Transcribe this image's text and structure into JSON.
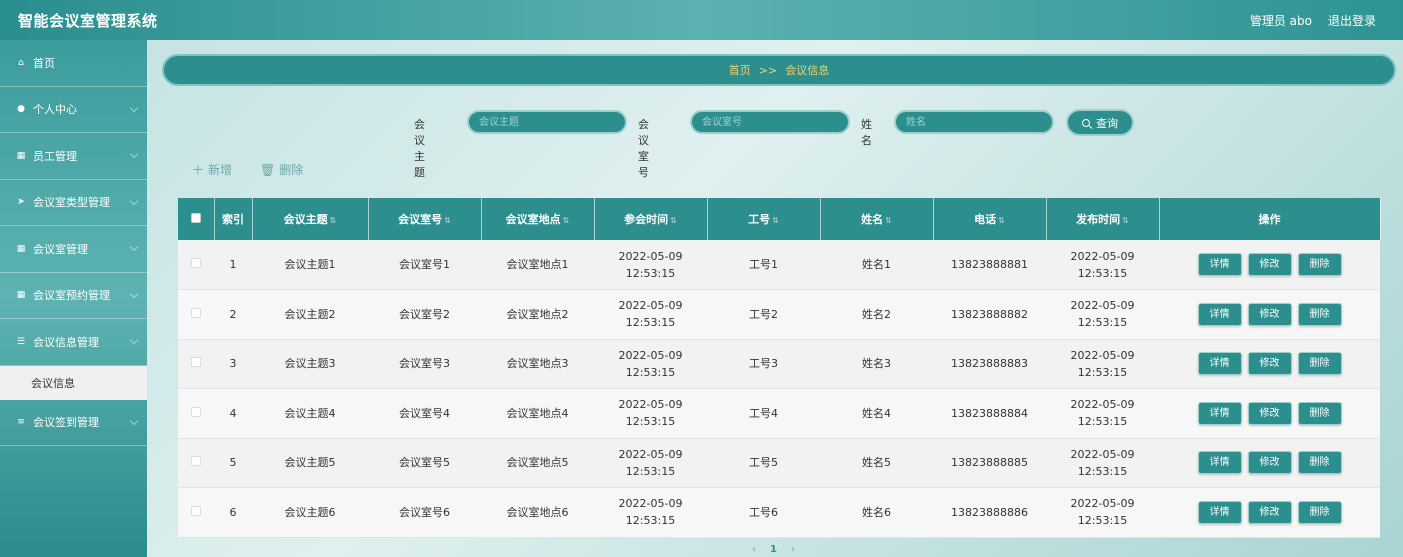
{
  "header": {
    "title": "智能会议室管理系统",
    "user": "管理员 abo",
    "logout": "退出登录"
  },
  "sidebar": {
    "items": [
      {
        "label": "首页",
        "icon": "home-icon"
      },
      {
        "label": "个人中心",
        "icon": "user-icon"
      },
      {
        "label": "员工管理",
        "icon": "grid-icon"
      },
      {
        "label": "会议室类型管理",
        "icon": "send-icon"
      },
      {
        "label": "会议室管理",
        "icon": "grid-icon"
      },
      {
        "label": "会议室预约管理",
        "icon": "grid-icon"
      },
      {
        "label": "会议信息管理",
        "icon": "sliders-icon"
      },
      {
        "label": "会议签到管理",
        "icon": "list-icon"
      }
    ],
    "active_sub": "会议信息"
  },
  "breadcrumb": {
    "home": "首页",
    "sep": ">>",
    "current": "会议信息"
  },
  "search": {
    "topic_label": "会议主题",
    "topic_placeholder": "会议主题",
    "room_label": "会议室号",
    "room_placeholder": "会议室号",
    "name_label": "姓名",
    "name_placeholder": "姓名",
    "query_label": "查询"
  },
  "actions": {
    "add": "新增",
    "delete": "删除"
  },
  "table": {
    "headers": [
      "索引",
      "会议主题",
      "会议室号",
      "会议室地点",
      "参会时间",
      "工号",
      "姓名",
      "电话",
      "发布时间",
      "操作"
    ],
    "buttons": {
      "detail": "详情",
      "edit": "修改",
      "delete": "删除"
    },
    "rows": [
      {
        "idx": "1",
        "topic": "会议主题1",
        "room": "会议室号1",
        "place": "会议室地点1",
        "time": "2022-05-09 12:53:15",
        "no": "工号1",
        "name": "姓名1",
        "phone": "13823888881",
        "pub": "2022-05-09 12:53:15"
      },
      {
        "idx": "2",
        "topic": "会议主题2",
        "room": "会议室号2",
        "place": "会议室地点2",
        "time": "2022-05-09 12:53:15",
        "no": "工号2",
        "name": "姓名2",
        "phone": "13823888882",
        "pub": "2022-05-09 12:53:15"
      },
      {
        "idx": "3",
        "topic": "会议主题3",
        "room": "会议室号3",
        "place": "会议室地点3",
        "time": "2022-05-09 12:53:15",
        "no": "工号3",
        "name": "姓名3",
        "phone": "13823888883",
        "pub": "2022-05-09 12:53:15"
      },
      {
        "idx": "4",
        "topic": "会议主题4",
        "room": "会议室号4",
        "place": "会议室地点4",
        "time": "2022-05-09 12:53:15",
        "no": "工号4",
        "name": "姓名4",
        "phone": "13823888884",
        "pub": "2022-05-09 12:53:15"
      },
      {
        "idx": "5",
        "topic": "会议主题5",
        "room": "会议室号5",
        "place": "会议室地点5",
        "time": "2022-05-09 12:53:15",
        "no": "工号5",
        "name": "姓名5",
        "phone": "13823888885",
        "pub": "2022-05-09 12:53:15"
      },
      {
        "idx": "6",
        "topic": "会议主题6",
        "room": "会议室号6",
        "place": "会议室地点6",
        "time": "2022-05-09 12:53:15",
        "no": "工号6",
        "name": "姓名6",
        "phone": "13823888886",
        "pub": "2022-05-09 12:53:15"
      }
    ]
  },
  "pager": {
    "prev": "‹",
    "current": "1",
    "next": "›"
  }
}
